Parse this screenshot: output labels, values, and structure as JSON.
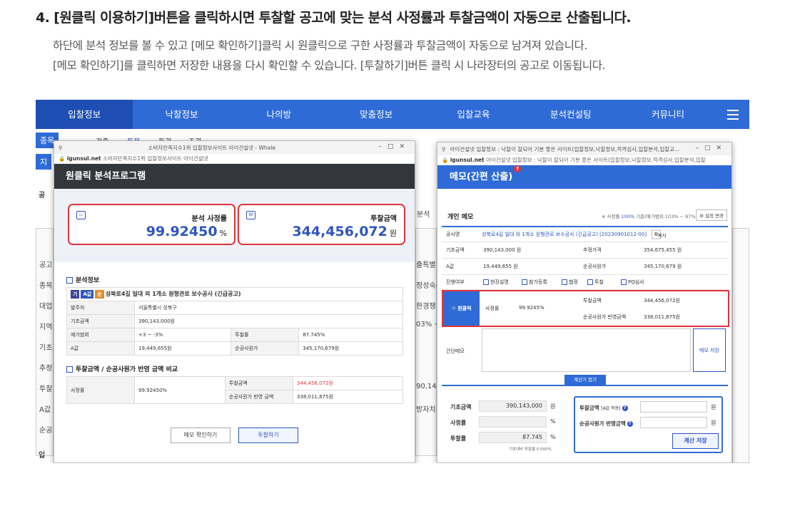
{
  "heading": "4. [원클릭 이용하기]버튼을 클릭하시면 투찰할 공고에 맞는 분석 사정률과 투찰금액이 자동으로 산출됩니다.",
  "desc1": "하단에 분석 정보를 볼 수 있고 [메모 확인하기]클릭 시 원클릭으로 구한 사정률과 투찰금액이 자동으로 남겨져 있습니다.",
  "desc2": "[메모 확인하기]를 클릭하면 저장한 내용을 다시 확인할 수 있습니다. [투찰하기]버튼 클릭 시 나라장터의 공고로 이동됩니다.",
  "nav": {
    "items": [
      "입찰정보",
      "낙찰정보",
      "나의방",
      "맞춤정보",
      "입찰교육",
      "분석컨설팅",
      "커뮤니티"
    ],
    "menu_icon": "hamburger-icon"
  },
  "bg": {
    "chip1": "종목",
    "chip2": "지",
    "filters": [
      "검출",
      "토목",
      "토건",
      "조경"
    ],
    "left_labels": [
      "공",
      "공고",
      "종목",
      "대업",
      "지역",
      "기초",
      "추정",
      "투찰",
      "A값",
      "순공"
    ],
    "right_labels": [
      "분석",
      "출특별",
      "정성숙(",
      "한경쟁",
      "03% ~",
      "90,143,",
      "방자치"
    ],
    "bottom_label": "입"
  },
  "w1": {
    "title": "소비자만족지수1위 입찰정보사이트 아이건설넷 - Whale",
    "url_domain": "igunsul.net",
    "url_text": "소비자만족지수1위 입찰정보사이트 아이건설넷",
    "header": "원클릭 분석프로그램",
    "card1": {
      "label": "분석 사정률",
      "value": "99.92450",
      "unit": "%"
    },
    "card2": {
      "label": "투찰금액",
      "value": "344,456,072",
      "unit": "원"
    },
    "sec1": "분석정보",
    "badges": [
      "기",
      "A값",
      "순"
    ],
    "project": "성북로4길 일대 외 1개소 원형관로 보수공사 (긴급공고)",
    "rows": [
      {
        "k": "발주처",
        "v": "서울특별시 성북구"
      },
      {
        "k": "기초금액",
        "v": "390,143,000원"
      }
    ],
    "range_k": "예가범위",
    "range_v": "+3 ~ -3%",
    "rate_k": "투찰률",
    "rate_v": "87.745%",
    "a_k": "A값",
    "a_v": "19,449,655원",
    "net_k": "순공사원가",
    "net_v": "345,170,679원",
    "sec2": "투찰금액 / 순공사원가 반영 금액 비교",
    "cmp_k": "사정률",
    "cmp_v": "99.92450%",
    "bid_k": "투찰금액",
    "bid_v": "344,456,072원",
    "netr_k": "순공사원가 반영 금액",
    "netr_v": "338,011,875원",
    "btn_memo": "메모 확인하기",
    "btn_bid": "투찰하기"
  },
  "w2": {
    "title": "아이건설넷 입찰정보 : 낙찰이 잘되어 기분 좋은 사이트(입찰정보,낙찰정보,적격심사,입찰분석,입찰교...",
    "url_domain": "igunsul.net",
    "url_text": "아이건설넷 입찰정보 : 낙찰이 잘되어 기분 좋은 사이트(입찰정보,낙찰정보,적격심사,입찰분석,입찰",
    "header": "메모(간편 산출)",
    "qmark": "?",
    "memo_title": "개인 메모",
    "note_pre": "※ 사정률",
    "note_hl": "100%",
    "note_post": "기준(예가범위:103% ~ 97%)",
    "set_btn": "설정 변경",
    "notice_k": "공사명",
    "notice_v": "성북로4길 일대 외 1개소 원형관로 보수공사 (긴급공고) [20230901012-00]",
    "copy_btn": "복사",
    "base_k": "기초금액",
    "base_v": "390,143,000 원",
    "est_k": "추정가격",
    "est_v": "354,675,455 원",
    "a_k": "A값",
    "a_v": "19,449,655 원",
    "net_k": "순공사원가",
    "net_v": "345,170,679 원",
    "prog_k": "진행여부",
    "checks": [
      "현장설명",
      "참가등록",
      "협정",
      "투찰",
      "PQ심사"
    ],
    "oc_label": "원클릭",
    "oc_rate_k": "사정률",
    "oc_rate_v": "99.9245%",
    "oc_bid_k": "투찰금액",
    "oc_bid_v": "344,456,072원",
    "oc_net_k": "순공사원가 반영금액",
    "oc_net_v": "338,011,875원",
    "memo_k": "간단메모",
    "memo_save": "메모 저장",
    "fold": "계산기 접기",
    "calc_base_k": "기초금액",
    "calc_base_v": "390,143,000",
    "calc_rate_k": "사정률",
    "calc_bidrate_k": "투찰률",
    "calc_bidrate_v": "87.745",
    "unit_won": "원",
    "unit_pct": "%",
    "box_bid_k": "투찰금액",
    "box_bid_sub": "[A값 적용]",
    "box_net_k": "순공사원가 반영금액",
    "calc_save": "계산 저장",
    "small_note": "기초대비 투찰율 0.000%"
  }
}
